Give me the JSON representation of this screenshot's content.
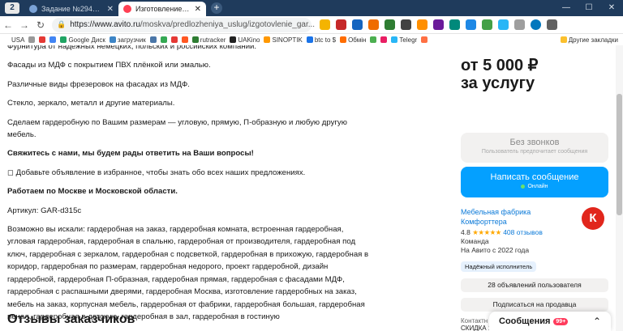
{
  "browser": {
    "tab_counter": "2",
    "tabs": [
      {
        "title": "Задание №2942183 - про",
        "active": false,
        "fav_color": "#7aa2d6"
      },
      {
        "title": "Изготовление гардероб",
        "active": true,
        "fav_color": "#ff4053"
      }
    ],
    "new_tab": "+",
    "window": {
      "minimize": "—",
      "maximize": "☐",
      "close": "✕"
    },
    "nav": {
      "back": "←",
      "forward": "→",
      "reload": "↻"
    },
    "url_host": "https://www.avito.ru",
    "url_path": "/moskva/predlozheniya_uslug/izgotovlenie_gar...",
    "bookmarks": [
      {
        "label": "USA",
        "color": "#ffffff"
      },
      {
        "label": "",
        "color": "#999999"
      },
      {
        "label": "",
        "color": "#e53935"
      },
      {
        "label": "",
        "color": "#4285f4"
      },
      {
        "label": "Google Диск",
        "color": "#1fa463"
      },
      {
        "label": "загрузчик",
        "color": "#3d85c6"
      },
      {
        "label": "",
        "color": "#4a76a8"
      },
      {
        "label": "",
        "color": "#34a853"
      },
      {
        "label": "",
        "color": "#e53935"
      },
      {
        "label": "",
        "color": "#ff5722"
      },
      {
        "label": "rutracker",
        "color": "#2e7d32"
      },
      {
        "label": "UAKino",
        "color": "#222222"
      },
      {
        "label": "SINOPTIK",
        "color": "#ff9800"
      },
      {
        "label": "btc to $",
        "color": "#1a73e8"
      },
      {
        "label": "Обмін",
        "color": "#ff6d00"
      },
      {
        "label": "",
        "color": "#4caf50"
      },
      {
        "label": "",
        "color": "#e91e63"
      },
      {
        "label": "Telegr",
        "color": "#29b6f6"
      },
      {
        "label": "",
        "color": "#ff7043"
      }
    ],
    "other_bookmarks": "Другие закладки"
  },
  "content": {
    "paragraphs": [
      "Фурнитура от надёжных немецких, польских и российских компаний.",
      "Фасады из МДФ с покрытием ПВХ плёнкой или эмалью.",
      "Различные виды фрезеровок на фасадах из МДФ.",
      "Стекло, зеркало, металл и другие материалы.",
      "Сделаем гардеробную по Вашим размерам — угловую, прямую, П-образную и любую другую мебель."
    ],
    "contact_bold": "Свяжитесь с нами, мы будем рады ответить на Ваши вопросы!",
    "favorite_note": "◻ Добавьте объявление в избранное, чтобы знать обо всех наших предложениях.",
    "region_bold": "Работаем по Москве и Московской области.",
    "article": "Артикул: GAR-d315c",
    "keywords": "Возможно вы искали: гардеробная на заказ, гардеробная комната, встроенная гардеробная, угловая гардеробная, гардеробная в спальню, гардеробная от производителя, гардеробная под ключ, гардеробная с зеркалом, гардеробная с подсветкой, гардеробная в прихожую, гардеробная в коридор, гардеробная по размерам, гардеробная недорого, проект гардеробной, дизайн гардеробной, гардеробная П-образная, гардеробная прямая, гардеробная с фасадами МДФ, гардеробная с распашными дверями, гардеробная Москва, изготовление гардеробных на заказ, мебель на заказ, корпусная мебель, гардеробная от фабрики, гардеробная большая, гардеробная пенал, гардеробная в детскую, гардеробная в зал, гардеробная в гостиную",
    "reviews_title": "Отзывы заказчиков"
  },
  "sidebar": {
    "price_line1": "от 5 000 ₽",
    "price_line2": "за услугу",
    "no_calls_title": "Без звонков",
    "no_calls_sub": "Пользователь предпочитает сообщения",
    "write_message": "Написать сообщение",
    "online": "Онлайн",
    "seller_name": "Мебельная фабрика Комфорттера",
    "rating": "4.8",
    "stars": "★★★★★",
    "reviews_count": "408 отзывов",
    "seller_type": "Команда",
    "seller_since": "На Авито с 2022 года",
    "badge": "Надёжный исполнитель",
    "logo_letter": "К",
    "ads_button": "28 объявлений пользователя",
    "subscribe_button": "Подписаться на продавца",
    "contact_label": "Контактн",
    "contact_value": "СКИДКА 10"
  },
  "chat": {
    "title": "Сообщения",
    "count": "99+",
    "chevron": "⌃"
  },
  "colors": {
    "accent_blue": "#04a0ff",
    "link_blue": "#0a79d8",
    "star_orange": "#ffa800",
    "avito_red": "#e1261c",
    "chrome_dark": "#1f3b5c"
  }
}
